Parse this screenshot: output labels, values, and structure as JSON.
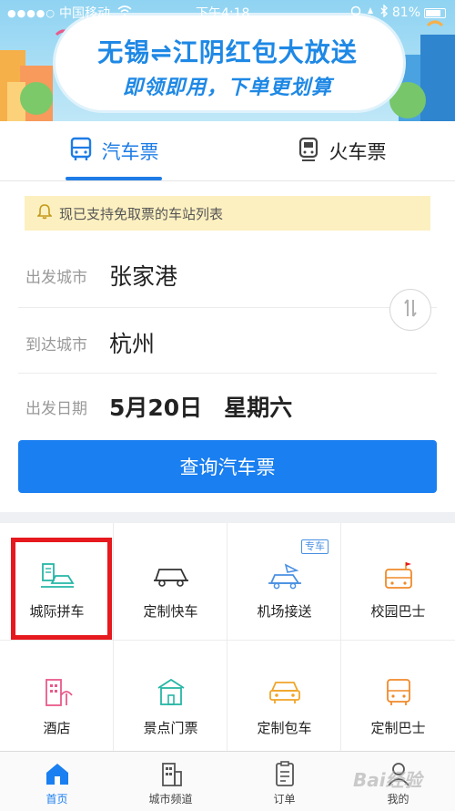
{
  "status_bar": {
    "signal": "●●●●○",
    "carrier": "中国移动",
    "time": "下午4:18",
    "battery": "81%",
    "battery_level": 0.81
  },
  "banner": {
    "title": "无锡⇌江阴红包大放送",
    "subtitle": "即领即用，下单更划算"
  },
  "tabs": [
    {
      "label": "汽车票",
      "icon": "bus-icon",
      "active": true
    },
    {
      "label": "火车票",
      "icon": "train-icon",
      "active": false
    }
  ],
  "notice": {
    "text": "现已支持免取票的车站列表",
    "icon": "bell-icon"
  },
  "form": {
    "departure": {
      "label": "出发城市",
      "value": "张家港"
    },
    "arrival": {
      "label": "到达城市",
      "value": "杭州"
    },
    "date": {
      "label": "出发日期",
      "value": "5月20日",
      "weekday": "星期六"
    },
    "swap_icon": "swap-icon",
    "search_label": "查询汽车票"
  },
  "services": [
    {
      "label": "城际拼车",
      "icon": "intercity-carpool-icon",
      "highlighted": true
    },
    {
      "label": "定制快车",
      "icon": "custom-express-car-icon"
    },
    {
      "label": "机场接送",
      "icon": "airport-transfer-icon",
      "tag": "专车"
    },
    {
      "label": "校园巴士",
      "icon": "campus-bus-icon"
    },
    {
      "label": "酒店",
      "icon": "hotel-icon"
    },
    {
      "label": "景点门票",
      "icon": "attraction-ticket-icon"
    },
    {
      "label": "定制包车",
      "icon": "charter-car-icon"
    },
    {
      "label": "定制巴士",
      "icon": "custom-bus-icon"
    }
  ],
  "bottom_nav": [
    {
      "label": "首页",
      "icon": "home-icon",
      "active": true
    },
    {
      "label": "城市频道",
      "icon": "city-channel-icon"
    },
    {
      "label": "订单",
      "icon": "order-icon"
    },
    {
      "label": "我的",
      "icon": "profile-icon"
    }
  ],
  "watermark": "Bai经验",
  "colors": {
    "accent": "#1a7ff0",
    "notice_bg": "#fdf0c0",
    "highlight": "#e5191e",
    "teal_icon": "#26b6a6",
    "orange_icon": "#f08a2a",
    "pink_icon": "#e95a8b"
  }
}
